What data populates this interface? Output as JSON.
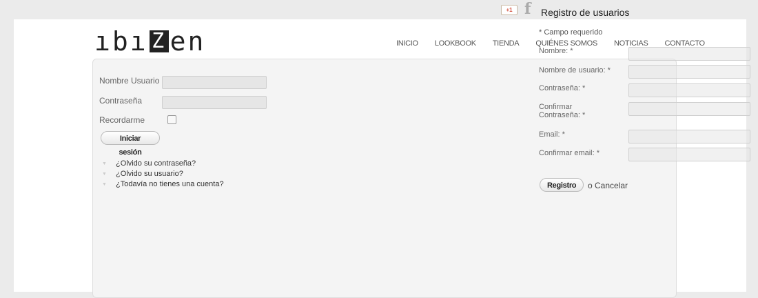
{
  "social": {
    "gplus_label": "+1",
    "fb_label": "f"
  },
  "registration": {
    "title": "Registro de usuarios",
    "required_note": "* Campo requerido",
    "fields": [
      {
        "label": "Nombre: *"
      },
      {
        "label": "Nombre de usuario: *"
      },
      {
        "label": "Contraseña: *"
      },
      {
        "label": "Confirmar Contraseña: *"
      },
      {
        "label": "Email: *"
      },
      {
        "label": "Confirmar email: *"
      }
    ],
    "submit_label": "Registro",
    "cancel_label": "o Cancelar"
  },
  "header": {
    "logo_parts": [
      "ıbı",
      "Z",
      "en"
    ],
    "nav": [
      "INICIO",
      "LOOKBOOK",
      "TIENDA",
      "QUIÉNES SOMOS",
      "NOTICIAS",
      "CONTACTO"
    ]
  },
  "login": {
    "username_label": "Nombre Usuario",
    "password_label": "Contraseña",
    "remember_label": "Recordarme",
    "submit_label": "Iniciar sesión",
    "links": [
      "¿Olvido su contraseña?",
      "¿Olvido su usuario?",
      "¿Todavía no tienes una cuenta?"
    ]
  }
}
